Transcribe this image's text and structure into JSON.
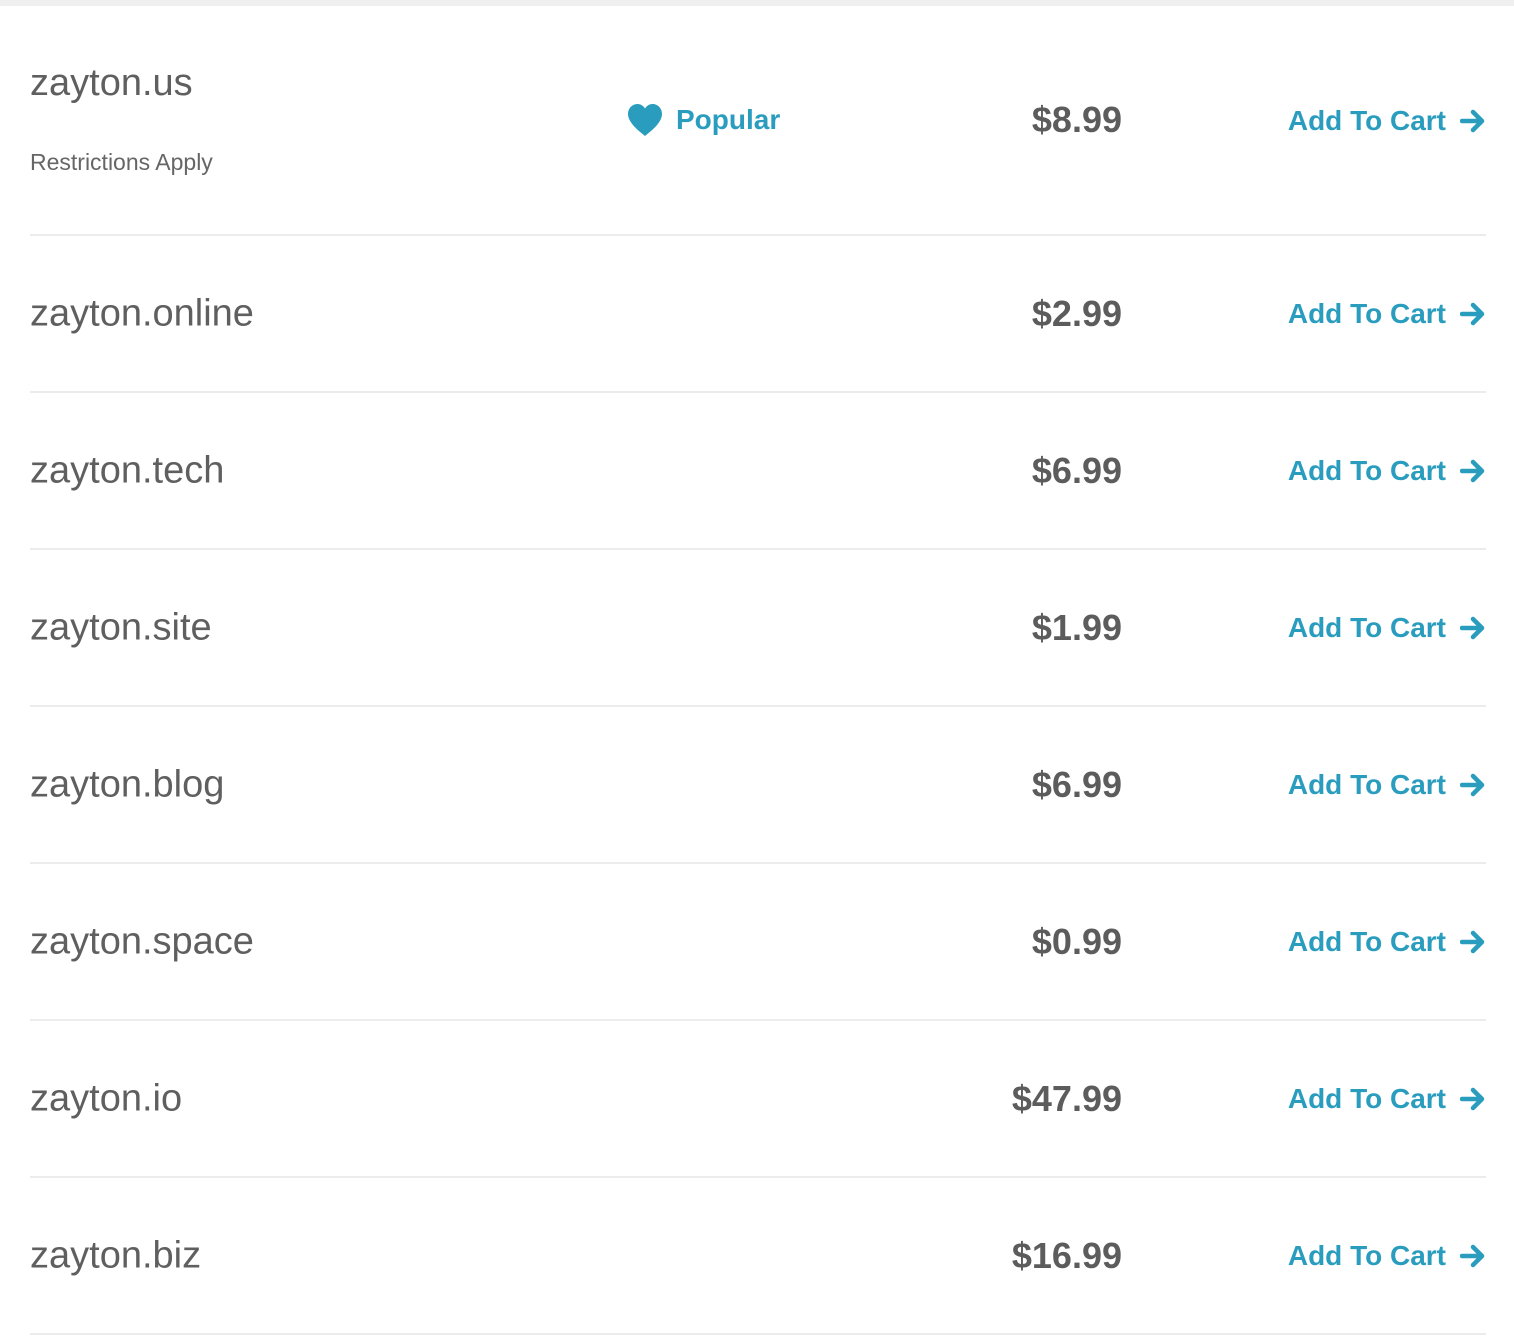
{
  "colors": {
    "accent": "#2a9dbf",
    "text": "#5f5f5f",
    "divider": "#ececec"
  },
  "badge": {
    "label": "Popular",
    "icon": "heart-icon"
  },
  "cart_label": "Add To Cart",
  "cart_icon": "arrow-right-icon",
  "results": [
    {
      "domain": "zayton.us",
      "note": "Restrictions Apply",
      "price": "$8.99",
      "popular": true
    },
    {
      "domain": "zayton.online",
      "price": "$2.99"
    },
    {
      "domain": "zayton.tech",
      "price": "$6.99"
    },
    {
      "domain": "zayton.site",
      "price": "$1.99"
    },
    {
      "domain": "zayton.blog",
      "price": "$6.99"
    },
    {
      "domain": "zayton.space",
      "price": "$0.99"
    },
    {
      "domain": "zayton.io",
      "price": "$47.99"
    },
    {
      "domain": "zayton.biz",
      "price": "$16.99"
    }
  ]
}
